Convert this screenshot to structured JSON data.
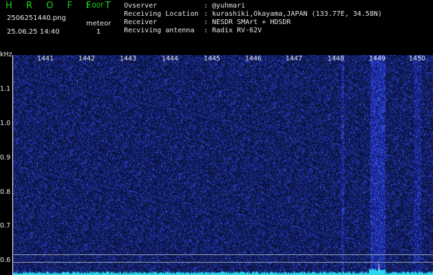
{
  "header": {
    "app_title": "H R O F F T",
    "version": "1.00f",
    "file_name": "2506251440.png",
    "date_time": "25.06.25 14:40",
    "meteor_label": "meteor",
    "meteor_count": "1"
  },
  "info": [
    {
      "key": "Ovserver",
      "value": ": @yuhmari"
    },
    {
      "key": "Receiving Location",
      "value": ": kurashiki,Okayama,JAPAN (133.77E, 34.58N)"
    },
    {
      "key": "Receiver",
      "value": ": NESDR SMArt + HDSDR"
    },
    {
      "key": "Recviving antenna",
      "value": ": Radix RV-62V"
    }
  ],
  "axis": {
    "y_label": "kHz",
    "y_ticks": [
      "1.1",
      "1.0",
      "0.9",
      "0.8",
      "0.7",
      "0.6"
    ],
    "x_ticks": [
      "1441",
      "1442",
      "1443",
      "1444",
      "1445",
      "1446",
      "1447",
      "1448",
      "1449",
      "1450"
    ]
  },
  "colors": {
    "title_green": "#18d818",
    "noise_blue": "#1a2aa0",
    "spectrum_cyan": "#28d8f0",
    "meteor_white": "#ffffff"
  }
}
